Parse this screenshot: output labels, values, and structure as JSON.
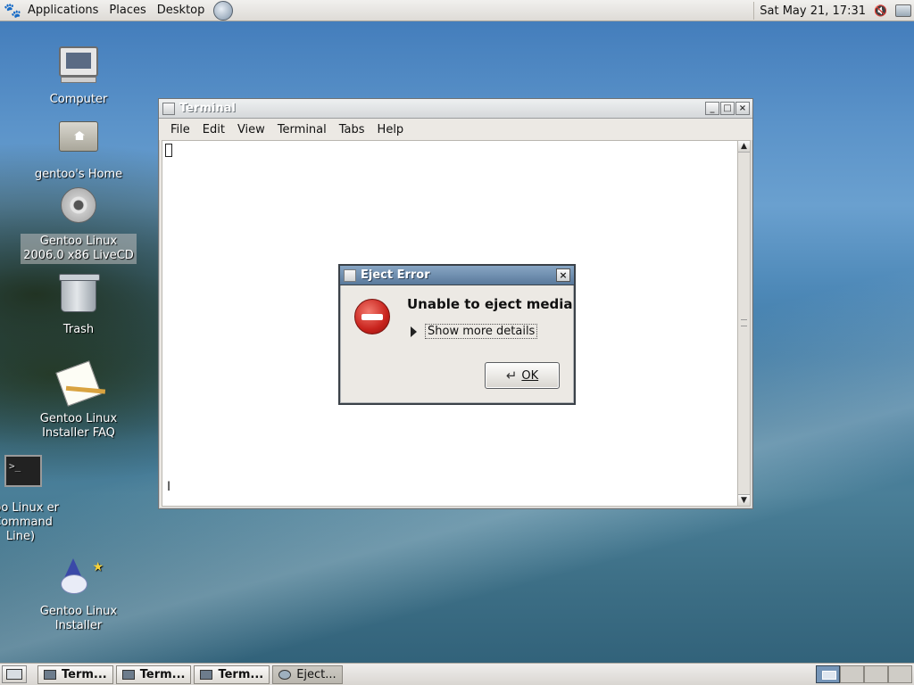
{
  "top_panel": {
    "menus": [
      "Applications",
      "Places",
      "Desktop"
    ],
    "clock": "Sat May 21, 17:31"
  },
  "desktop_icons": [
    {
      "label": "Computer",
      "icon": "computer-icon"
    },
    {
      "label": "gentoo's Home",
      "icon": "home-folder-icon"
    },
    {
      "label": "Gentoo Linux 2006.0 x86 LiveCD",
      "icon": "cd-icon",
      "selected": true
    },
    {
      "label": "Trash",
      "icon": "trash-icon"
    },
    {
      "label": "Gentoo Linux Installer FAQ",
      "icon": "notepad-icon"
    },
    {
      "label": "ntoo Linux er (Command Line)",
      "icon": "terminal-icon"
    },
    {
      "label": "Gentoo Linux Installer",
      "icon": "wizard-icon"
    }
  ],
  "terminal": {
    "title": "Terminal",
    "menus": [
      "File",
      "Edit",
      "View",
      "Terminal",
      "Tabs",
      "Help"
    ]
  },
  "dialog": {
    "title": "Eject Error",
    "heading": "Unable to eject media",
    "details_label": "Show more details",
    "ok_label": "OK"
  },
  "taskbar": {
    "items": [
      {
        "label": "Term...",
        "active": false
      },
      {
        "label": "Term...",
        "active": false
      },
      {
        "label": "Term...",
        "active": false
      },
      {
        "label": "Eject...",
        "active": true
      }
    ],
    "workspaces": 4,
    "current_workspace": 1
  }
}
